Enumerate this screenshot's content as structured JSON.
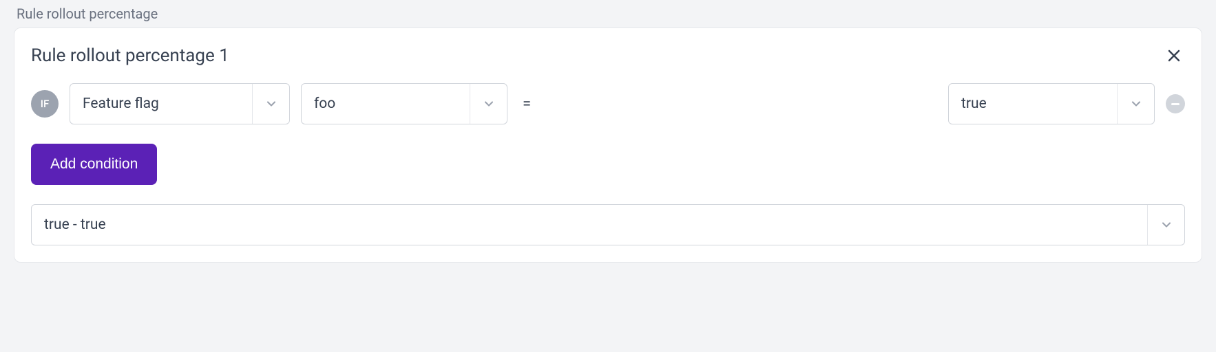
{
  "section": {
    "label": "Rule rollout percentage"
  },
  "rule": {
    "title": "Rule rollout percentage 1",
    "if_label": "IF",
    "attribute_select": "Feature flag",
    "flag_select": "foo",
    "operator": "=",
    "value_select": "true",
    "add_condition_label": "Add condition",
    "result_select": "true - true"
  }
}
